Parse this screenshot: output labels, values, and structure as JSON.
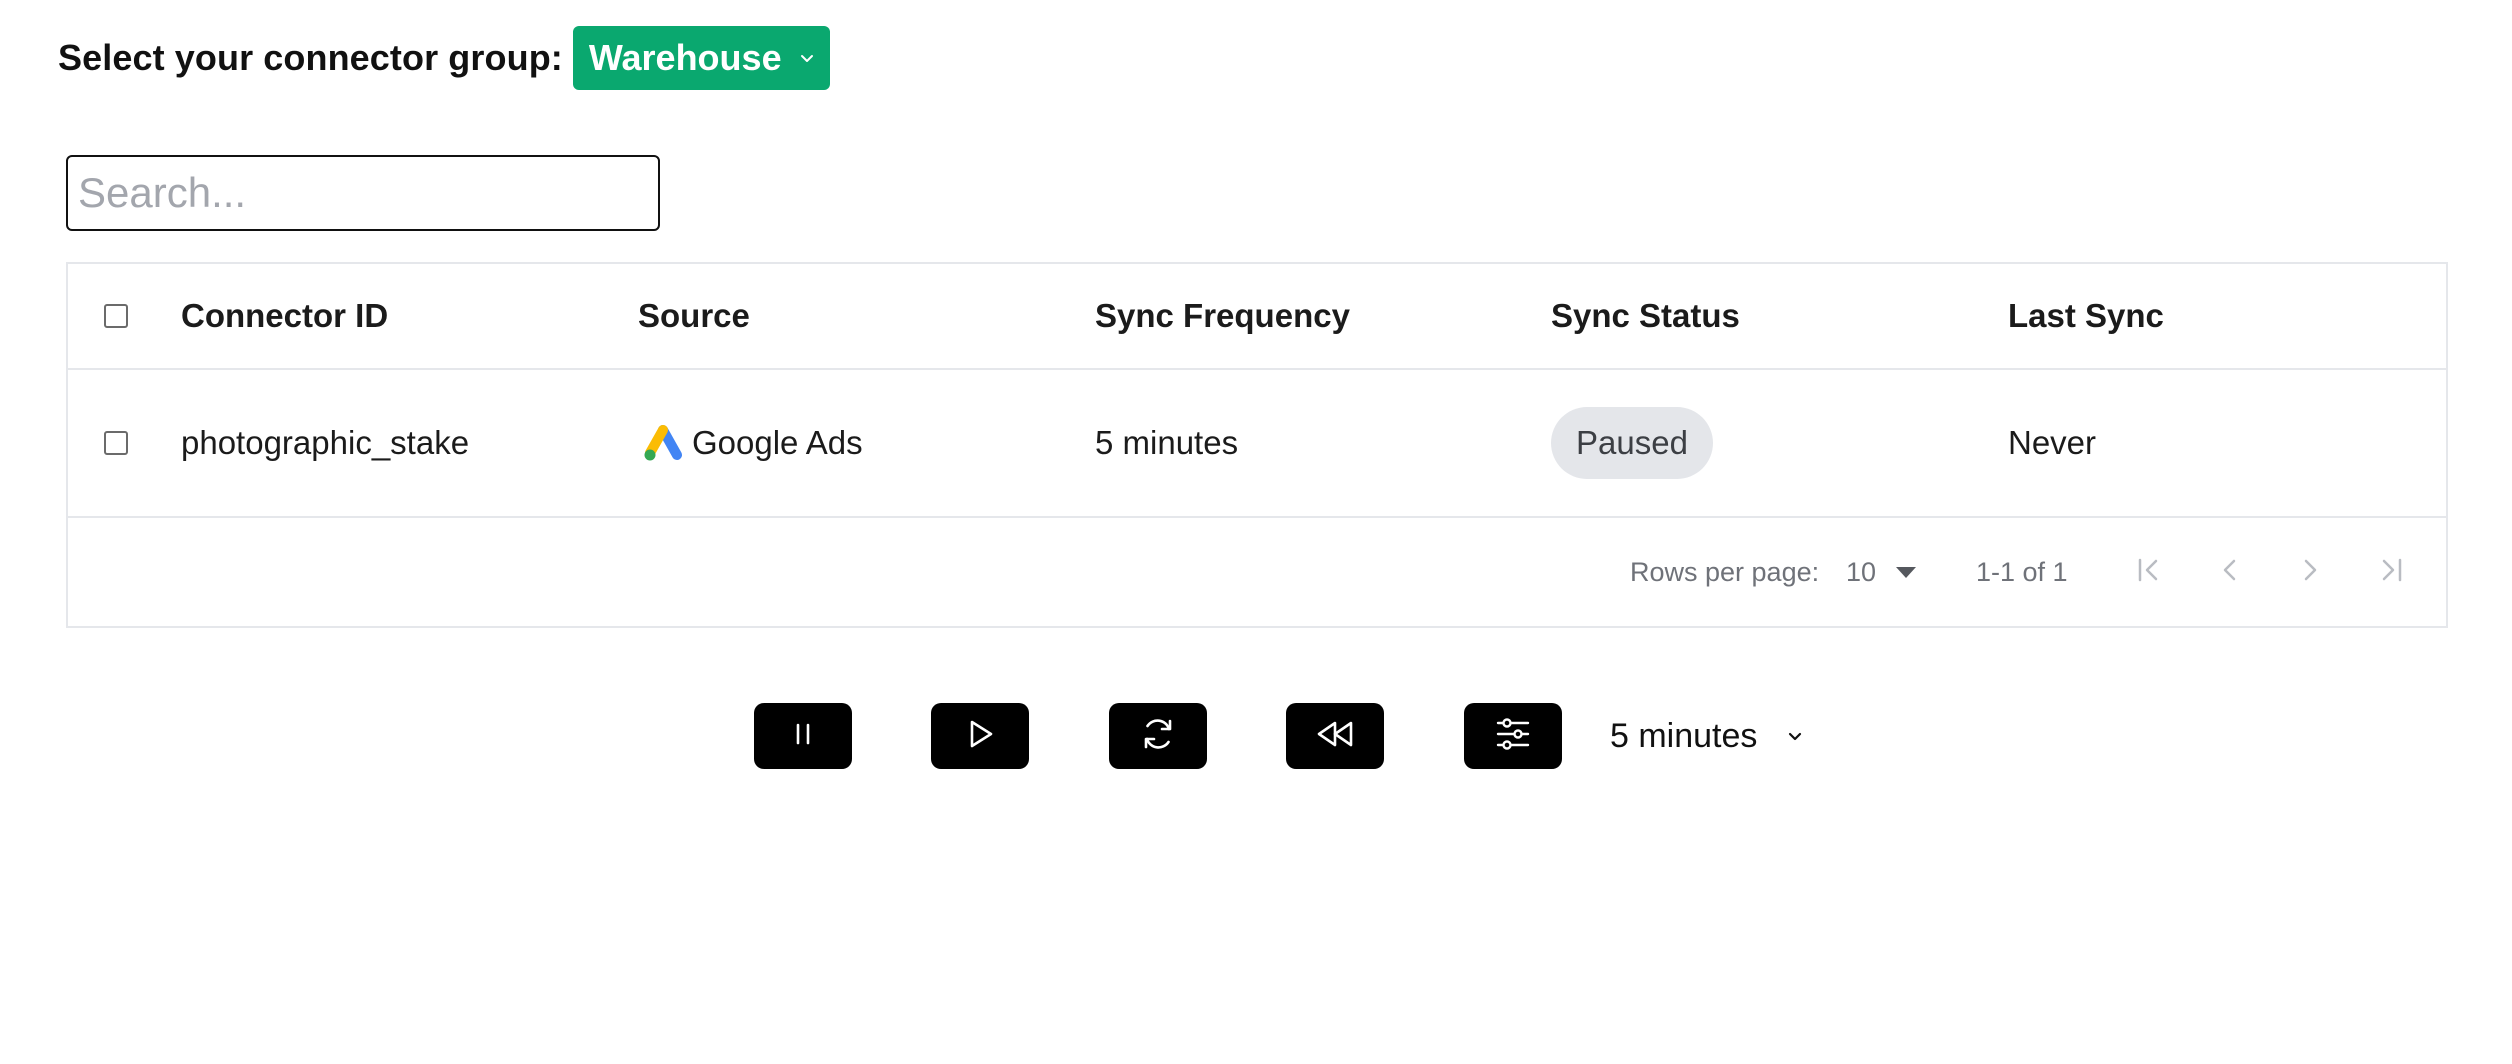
{
  "header": {
    "label": "Select your connector group:",
    "group_value": "Warehouse"
  },
  "search": {
    "placeholder": "Search...",
    "value": ""
  },
  "table": {
    "columns": [
      "Connector ID",
      "Source",
      "Sync Frequency",
      "Sync Status",
      "Last Sync"
    ],
    "rows": [
      {
        "connector_id": "photographic_stake",
        "source": "Google Ads",
        "source_icon": "google-ads-icon",
        "sync_frequency": "5 minutes",
        "sync_status": "Paused",
        "last_sync": "Never"
      }
    ]
  },
  "pagination": {
    "rows_per_page_label": "Rows per page:",
    "rows_per_page": "10",
    "range": "1-1 of 1"
  },
  "toolbar": {
    "buttons": [
      "pause-icon",
      "play-icon",
      "sync-icon",
      "rewind-icon",
      "sliders-icon"
    ],
    "frequency_value": "5 minutes"
  },
  "colors": {
    "brand_green": "#0aa86f",
    "toolbar_button": "#000000",
    "badge_bg": "#e4e6ea",
    "border": "#e5e7eb"
  }
}
